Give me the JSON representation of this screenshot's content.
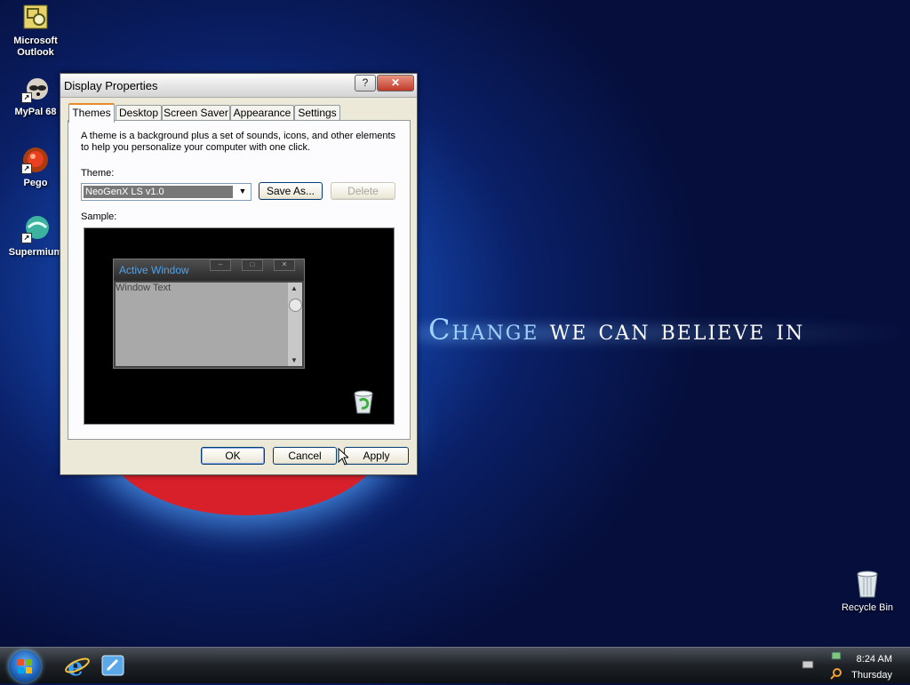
{
  "desktop": {
    "icons": [
      {
        "label1": "Microsoft",
        "label2": "Outlook"
      },
      {
        "label1": "MyPal 68",
        "label2": ""
      },
      {
        "label1": "Pego",
        "label2": ""
      },
      {
        "label1": "Supermium",
        "label2": ""
      }
    ],
    "slogan_word1": "Change",
    "slogan_rest": "we can believe in",
    "recycle_bin": "Recycle Bin"
  },
  "dialog": {
    "title": "Display Properties",
    "help_glyph": "?",
    "close_glyph": "✕",
    "tabs": [
      "Themes",
      "Desktop",
      "Screen Saver",
      "Appearance",
      "Settings"
    ],
    "description": "A theme is a background plus a set of sounds, icons, and other elements to help you personalize your computer with one click.",
    "theme_label": "Theme:",
    "theme_value": "NeoGenX LS v1.0",
    "save_as": "Save As...",
    "delete": "Delete",
    "sample_label": "Sample:",
    "sample_window": {
      "title": "Active Window",
      "text": "Window Text"
    },
    "buttons": {
      "ok": "OK",
      "cancel": "Cancel",
      "apply": "Apply"
    }
  },
  "taskbar": {
    "time": "8:24 AM",
    "day": "Thursday"
  },
  "colors": {
    "slogan_accent": "#9fd2ff",
    "sample_title": "#4aa3f0",
    "close_red": "#c0392b"
  }
}
